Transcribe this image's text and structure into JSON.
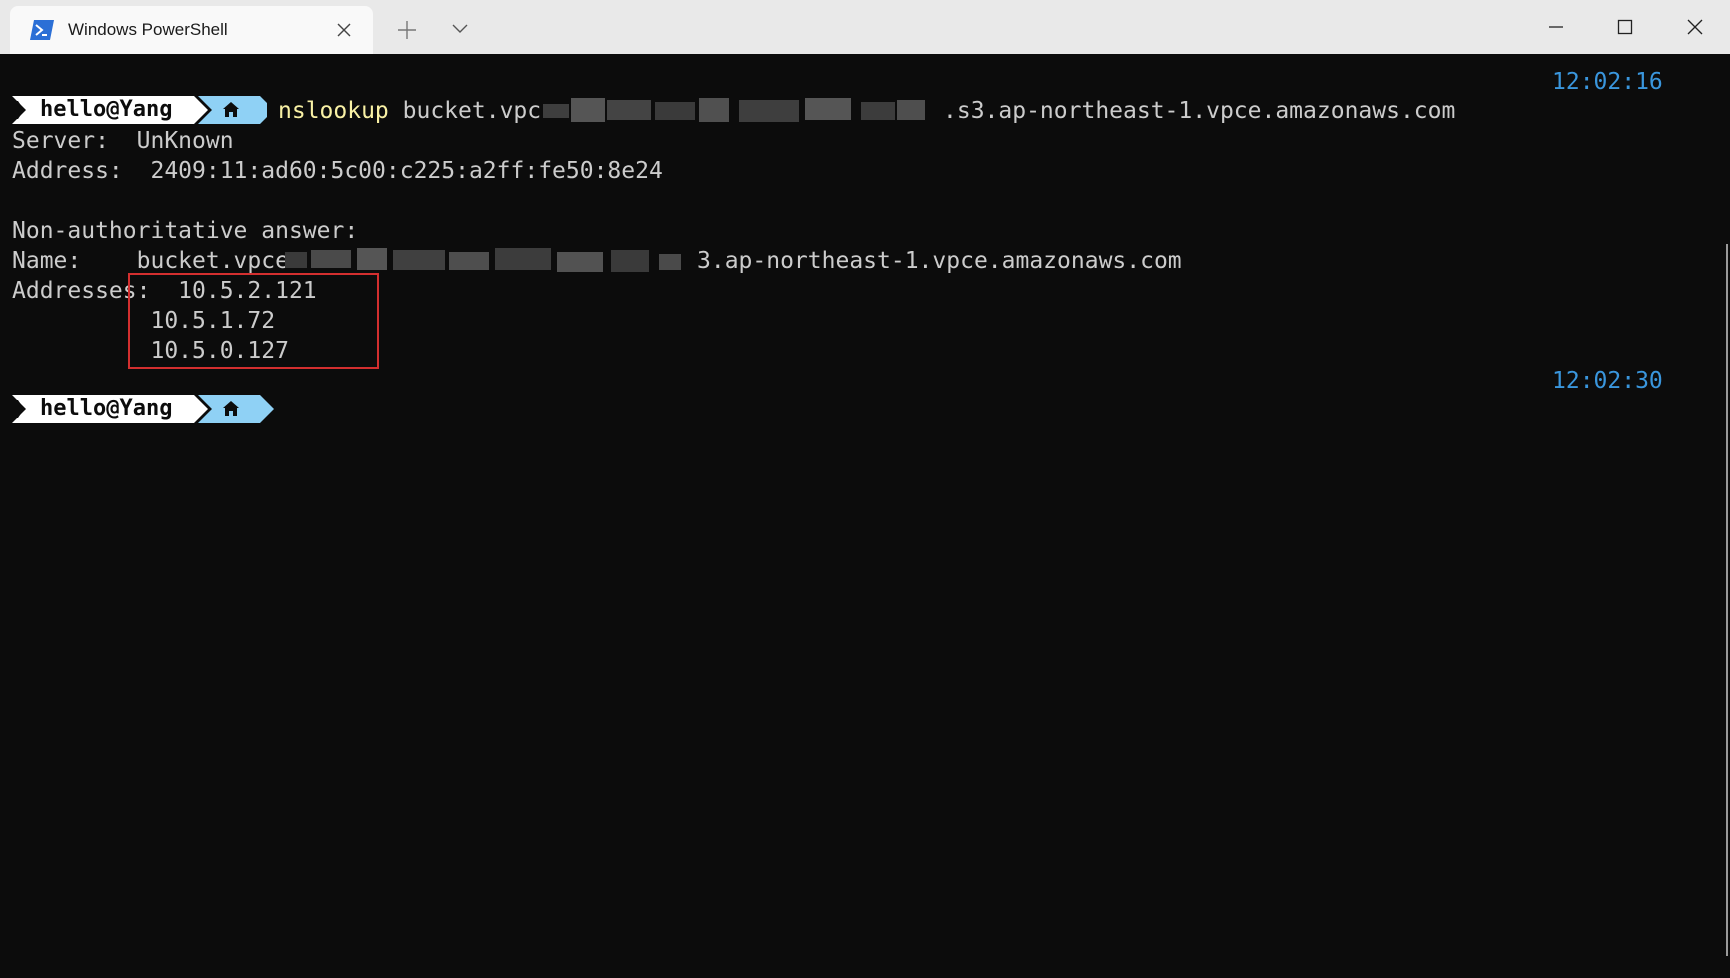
{
  "window": {
    "tab_title": "Windows PowerShell",
    "new_tab_icon": "plus-icon",
    "dropdown_icon": "chevron-down-icon",
    "controls": [
      "minimize-icon",
      "maximize-icon",
      "close-icon"
    ]
  },
  "colors": {
    "terminal_bg": "#0c0c0c",
    "text": "#cccccc",
    "command": "#f9f1a5",
    "timestamp": "#3a96dd",
    "prompt_user_bg": "#ffffff",
    "prompt_dir_bg": "#8fd1f5",
    "highlight_box": "#d32f2f"
  },
  "terminal": {
    "blocks": [
      {
        "timestamp": "12:02:16",
        "prompt_user": "hello@Yang",
        "prompt_dir_icon": "home-icon",
        "command": "nslookup",
        "arg_prefix": "bucket.vpc",
        "arg_suffix": ".s3.ap-northeast-1.vpce.amazonaws.com"
      },
      {
        "timestamp": "12:02:30",
        "prompt_user": "hello@Yang",
        "prompt_dir_icon": "home-icon"
      }
    ],
    "output": {
      "server": "Server:  UnKnown",
      "address": "Address:  2409:11:ad60:5c00:c225:a2ff:fe50:8e24",
      "non_auth": "Non-authoritative answer:",
      "name_label": "Name:    bucket.vpce",
      "name_suffix": "3.ap-northeast-1.vpce.amazonaws.com",
      "addresses_label": "Addresses:  10.5.2.121",
      "address_2": "          10.5.1.72",
      "address_3": "          10.5.0.127"
    }
  }
}
